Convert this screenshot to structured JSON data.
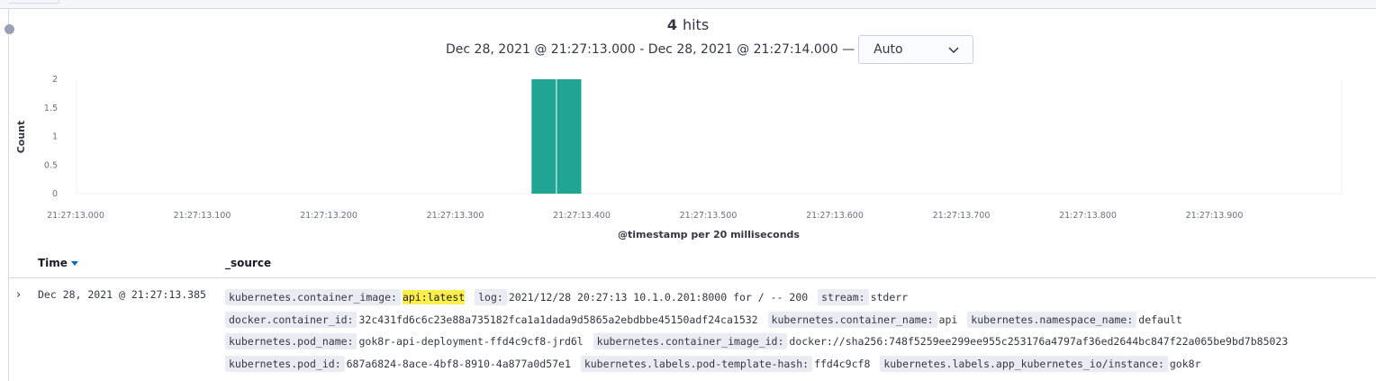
{
  "hits": {
    "count": "4",
    "label": "hits"
  },
  "time_range": {
    "text": "Dec 28, 2021 @ 21:27:13.000 - Dec 28, 2021 @ 21:27:14.000 —"
  },
  "interval": {
    "selected": "Auto"
  },
  "chart_data": {
    "type": "bar",
    "xlabel": "@timestamp per 20 milliseconds",
    "ylabel": "Count",
    "ylim": [
      0,
      2
    ],
    "y_ticks": [
      "0",
      "0.5",
      "1",
      "1.5",
      "2"
    ],
    "x_ticks": [
      "21:27:13.000",
      "21:27:13.100",
      "21:27:13.200",
      "21:27:13.300",
      "21:27:13.400",
      "21:27:13.500",
      "21:27:13.600",
      "21:27:13.700",
      "21:27:13.800",
      "21:27:13.900"
    ],
    "x_range_ms": [
      0,
      1000
    ],
    "bucket_ms": 20,
    "bars": [
      {
        "start_ms": 360,
        "value": 2
      },
      {
        "start_ms": 380,
        "value": 2
      }
    ],
    "bar_color": "#20a494",
    "grid": false
  },
  "table": {
    "columns": {
      "time": "Time",
      "source": "_source"
    },
    "rows": [
      {
        "time": "Dec 28, 2021 @ 21:27:13.385",
        "fields": [
          {
            "key": "kubernetes.container_image:",
            "value": "api:latest",
            "highlight": true
          },
          {
            "key": "log:",
            "value": "2021/12/28 20:27:13 10.1.0.201:8000 for / -- 200"
          },
          {
            "key": "stream:",
            "value": "stderr"
          },
          {
            "key": "docker.container_id:",
            "value": "32c431fd6c6c23e88a735182fca1a1dada9d5865a2ebdbbe45150adf24ca1532"
          },
          {
            "key": "kubernetes.container_name:",
            "value": "api"
          },
          {
            "key": "kubernetes.namespace_name:",
            "value": "default"
          },
          {
            "key": "kubernetes.pod_name:",
            "value": "gok8r-api-deployment-ffd4c9cf8-jrd6l"
          },
          {
            "key": "kubernetes.container_image_id:",
            "value": "docker://sha256:748f5259ee299ee955c253176a4797af36ed2644bc847f22a065be9bd7b85023"
          },
          {
            "key": "kubernetes.pod_id:",
            "value": "687a6824-8ace-4bf8-8910-4a877a0d57e1"
          },
          {
            "key": "kubernetes.labels.pod-template-hash:",
            "value": "ffd4c9cf8"
          },
          {
            "key": "kubernetes.labels.app_kubernetes_io/instance:",
            "value": "gok8r"
          }
        ]
      }
    ]
  }
}
